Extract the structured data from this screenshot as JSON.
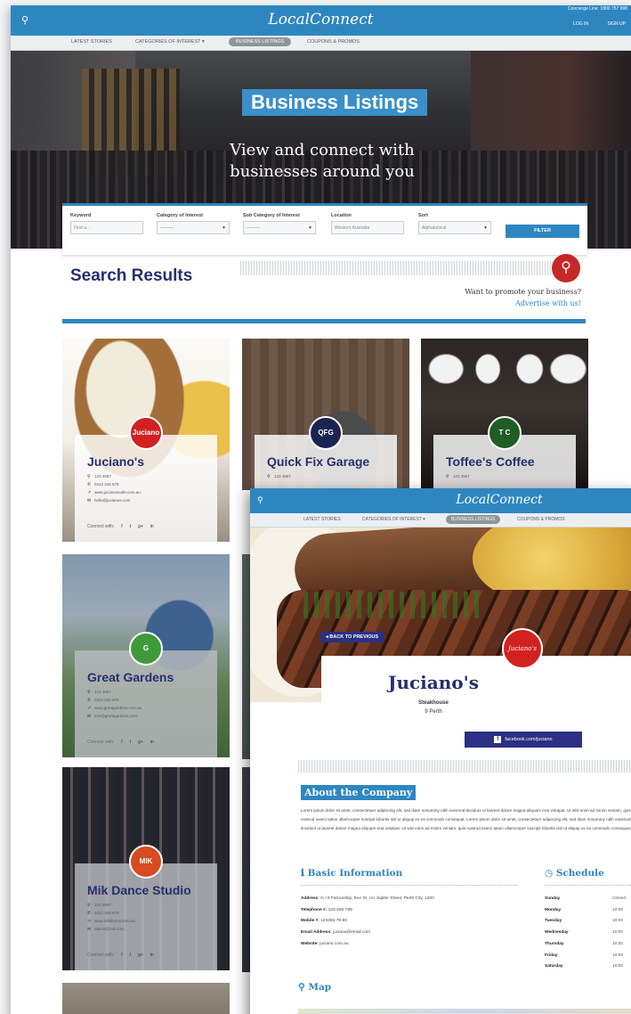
{
  "colors": {
    "primary": "#2e86c1",
    "navy": "#25306e",
    "accent_red": "#c62828",
    "indigo_button": "#2c2f84"
  },
  "listing_page": {
    "header": {
      "logo": "LocalConnect",
      "search_icon": "search-icon",
      "concierge": "Concierge Line: 1800 757 998",
      "login": "LOG IN",
      "signup": "SIGN UP"
    },
    "nav": [
      "LATEST STORIES",
      "CATEGORIES OF INTEREST ▾",
      "BUSINESS LISTINGS",
      "COUPONS & PROMOS"
    ],
    "hero": {
      "title": "Business Listings",
      "subtitle": "View and connect with businesses around you"
    },
    "filter": {
      "keyword": {
        "label": "Keyword",
        "placeholder": "Find a..."
      },
      "category": {
        "label": "Category of Interest",
        "value": "———"
      },
      "subcategory": {
        "label": "Sub Category of Interest",
        "value": "———"
      },
      "location": {
        "label": "Location",
        "value": "Western Australia"
      },
      "sort": {
        "label": "Sort",
        "value": "Alphabetical"
      },
      "button": "FILTER"
    },
    "results_title": "Search Results",
    "promo": {
      "icon": "search-icon",
      "question": "Want to promote your business?",
      "link": "Advertise with us!"
    },
    "cards": [
      {
        "name": "Juciano's",
        "badge": "Juciano",
        "phone": "123 4567",
        "mobile": "0412 345 678",
        "web": "www.jucianoscafe.com.au",
        "email": "hello@jucianos.com",
        "connect": "Connect with:"
      },
      {
        "name": "Quick Fix Garage",
        "badge": "QFG",
        "phone": "123 4567"
      },
      {
        "name": "Toffee's Coffee",
        "badge": "T C",
        "phone": "123 4567"
      },
      {
        "name": "Great Gardens",
        "badge": "G",
        "phone": "123 4567",
        "mobile": "0412 345 678",
        "web": "www.greatgardens.com.au",
        "email": "info@greatgardens.com",
        "connect": "Connect with:"
      },
      {
        "name": "Mik Dance Studio",
        "badge": "MIK",
        "phone": "123 4567",
        "mobile": "0412 345 678",
        "web": "www.mikdance.com.au",
        "email": "dance@mik.com",
        "connect": "Connect with:"
      }
    ],
    "social_icons": [
      "f",
      "t",
      "g+",
      "in"
    ]
  },
  "detail_page": {
    "header": {
      "logo": "LocalConnect",
      "search_icon": "search-icon"
    },
    "nav": [
      "LATEST STORIES",
      "CATEGORIES OF INTEREST ▾",
      "BUSINESS LISTINGS",
      "COUPONS & PROMOS"
    ],
    "back_button": "◂ BACK TO PREVIOUS",
    "badge": "Juciano's",
    "name": "Juciano's",
    "type": "Steakhouse",
    "location": "9 Perth",
    "facebook_button": "facebook.com/juciano",
    "about_title": "About the Company",
    "about_text": "Lorem ipsum dolor sit amet, consectetuer adipiscing elit, sed diam nonummy nibh euismod tincidunt ut laoreet dolore magna aliquam erat volutpat. Ut wisi enim ad minim veniam, quis nostrud exerci tation ullamcorper suscipit lobortis nisl ut aliquip ex ea commodo consequat. Lorem ipsum dolor sit amet, consectetuer adipiscing elit, sed diam nonummy nibh euismod tincidunt ut laoreet dolore magna aliquam erat volutpat. Ut wisi enim ad minim veniam, quis nostrud exerci tation ullamcorper suscipit lobortis nisl ut aliquip ex ea commodo consequat.",
    "basic_info_title": "ℹ Basic Information",
    "basic_info": [
      {
        "label": "Address:",
        "value": "G / 9 Falconship, Eve St, cor Jupiter Street, Perth City, 1200"
      },
      {
        "label": "Telephone #:",
        "value": "123-456-789"
      },
      {
        "label": "Mobile #:",
        "value": "123456-78-90"
      },
      {
        "label": "Email Address:",
        "value": "juciano@email.com"
      },
      {
        "label": "Website:",
        "value": "juciano.com.au"
      }
    ],
    "schedule_title": "◷ Schedule",
    "schedule": [
      {
        "day": "Sunday",
        "time": "Closed"
      },
      {
        "day": "Monday",
        "time": "10:00"
      },
      {
        "day": "Tuesday",
        "time": "10:00"
      },
      {
        "day": "Wednesday",
        "time": "10:00"
      },
      {
        "day": "Thursday",
        "time": "10:00"
      },
      {
        "day": "Friday",
        "time": "10:00"
      },
      {
        "day": "Saturday",
        "time": "10:00"
      }
    ],
    "map_title": "⚲ Map"
  }
}
